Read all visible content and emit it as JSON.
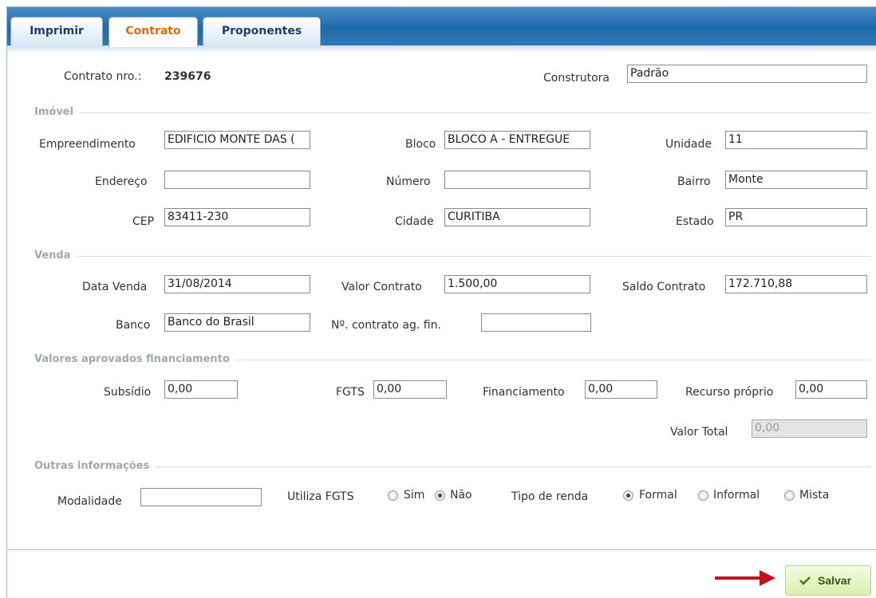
{
  "tabs": [
    {
      "label": "Imprimir",
      "active": false
    },
    {
      "label": "Contrato",
      "active": true
    },
    {
      "label": "Proponentes",
      "active": false
    }
  ],
  "header": {
    "contrato_label": "Contrato nro.:",
    "contrato_value": "239676",
    "construtora_label": "Construtora",
    "construtora_value": "Padrão"
  },
  "imovel": {
    "section": "Imóvel",
    "empreendimento_label": "Empreendimento",
    "empreendimento_value": "EDIFICIO MONTE DAS (",
    "bloco_label": "Bloco",
    "bloco_value": "BLOCO A - ENTREGUE",
    "unidade_label": "Unidade",
    "unidade_value": "11",
    "endereco_label": "Endereço",
    "endereco_value": "",
    "numero_label": "Número",
    "numero_value": "",
    "bairro_label": "Bairro",
    "bairro_value": "Monte",
    "cep_label": "CEP",
    "cep_value": "83411-230",
    "cidade_label": "Cidade",
    "cidade_value": "CURITIBA",
    "estado_label": "Estado",
    "estado_value": "PR"
  },
  "venda": {
    "section": "Venda",
    "data_label": "Data Venda",
    "data_value": "31/08/2014",
    "valor_label": "Valor Contrato",
    "valor_value": "1.500,00",
    "saldo_label": "Saldo Contrato",
    "saldo_value": "172.710,88",
    "banco_label": "Banco",
    "banco_value": "Banco do Brasil",
    "contrato_ag_label": "Nº. contrato ag. fin.",
    "contrato_ag_value": ""
  },
  "valores": {
    "section": "Valores aprovados financiamento",
    "subsidio_label": "Subsídio",
    "subsidio_value": "0,00",
    "fgts_label": "FGTS",
    "fgts_value": "0,00",
    "financiamento_label": "Financiamento",
    "financiamento_value": "0,00",
    "recurso_label": "Recurso próprio",
    "recurso_value": "0,00",
    "total_label": "Valor Total",
    "total_value": "0,00"
  },
  "outras": {
    "section": "Outras informações",
    "modalidade_label": "Modalidade",
    "modalidade_value": "",
    "utiliza_fgts_label": "Utiliza FGTS",
    "fgts_options": [
      "Sim",
      "Não"
    ],
    "fgts_selected": "Não",
    "tipo_renda_label": "Tipo de renda",
    "renda_options": [
      "Formal",
      "Informal",
      "Mista"
    ],
    "renda_selected": "Formal"
  },
  "actions": {
    "save_label": "Salvar",
    "check_icon": "check-icon",
    "arrow_color": "#c0141c"
  }
}
